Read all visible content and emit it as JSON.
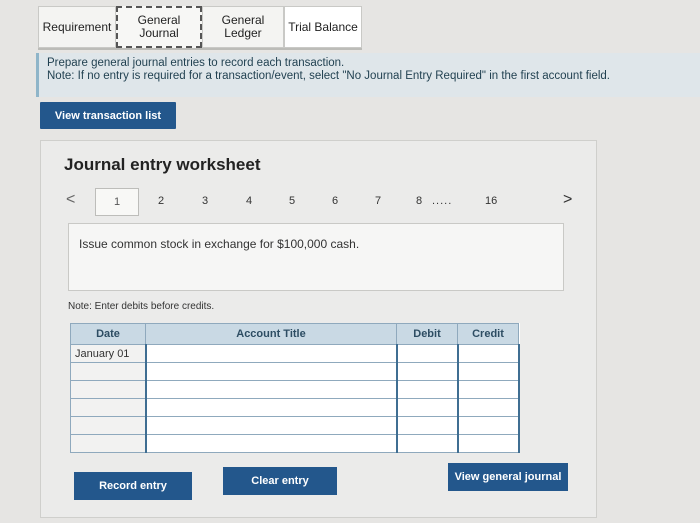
{
  "tabs": {
    "requirement": "Requirement",
    "general_journal": "General\nJournal",
    "general_ledger": "General\nLedger",
    "trial_balance": "Trial Balance"
  },
  "instructions": {
    "line1": "Prepare general journal entries to record each transaction.",
    "line2": "Note: If no entry is required for a transaction/event, select \"No Journal Entry Required\" in the first account field."
  },
  "view_transaction_list": "View transaction list",
  "worksheet": {
    "title": "Journal entry worksheet",
    "pager": {
      "prev": "<",
      "pages": [
        "1",
        "2",
        "3",
        "4",
        "5",
        "6",
        "7",
        "8"
      ],
      "ellipsis": ".....",
      "last": "16",
      "next": ">"
    },
    "description": "Issue common stock in exchange for $100,000 cash.",
    "note": "Note: Enter debits before credits.",
    "table": {
      "headers": {
        "date": "Date",
        "account": "Account Title",
        "debit": "Debit",
        "credit": "Credit"
      },
      "first_date": "January 01"
    },
    "buttons": {
      "record": "Record entry",
      "clear": "Clear entry",
      "view_journal": "View general journal"
    }
  }
}
